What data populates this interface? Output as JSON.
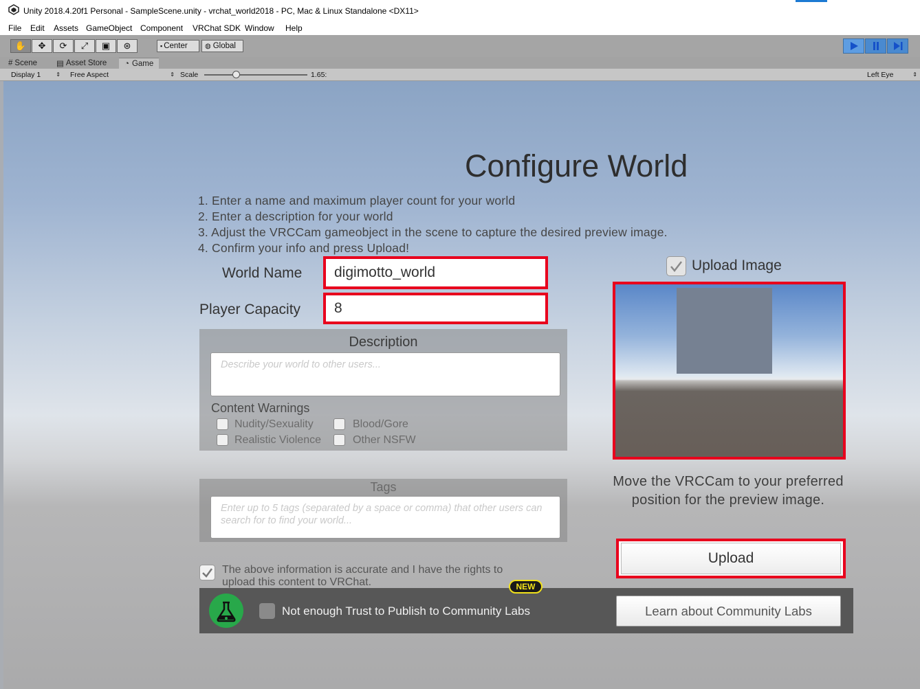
{
  "window": {
    "title": "Unity 2018.4.20f1 Personal - SampleScene.unity - vrchat_world2018 - PC, Mac & Linux Standalone <DX11>"
  },
  "menu": [
    "File",
    "Edit",
    "Assets",
    "GameObject",
    "Component",
    "VRChat SDK",
    "Window",
    "Help"
  ],
  "toolbar": {
    "tools": [
      "hand-tool",
      "move-tool",
      "rotate-tool",
      "scale-tool",
      "rect-tool",
      "transform-tool"
    ],
    "pivot_label": "Center",
    "rotation_label": "Global",
    "playback": [
      "play",
      "pause",
      "step"
    ]
  },
  "tabs": [
    {
      "label": "Scene",
      "icon": "grid-icon"
    },
    {
      "label": "Asset Store",
      "icon": "store-icon"
    },
    {
      "label": "Game",
      "icon": "pacman-icon",
      "active": true
    }
  ],
  "game_toolbar": {
    "display": "Display 1",
    "aspect": "Free Aspect",
    "scale_label": "Scale",
    "scale_value": "1.65:",
    "eye": "Left Eye"
  },
  "configure": {
    "heading": "Configure World",
    "steps": [
      "1. Enter a name and maximum player count for your world",
      "2. Enter a description for your world",
      "3. Adjust the VRCCam gameobject in the scene to capture the desired preview image.",
      "4. Confirm your info and press Upload!"
    ],
    "world_name_label": "World Name",
    "world_name_value": "digimotto_world",
    "player_capacity_label": "Player Capacity",
    "player_capacity_value": "8",
    "description_title": "Description",
    "description_placeholder": "Describe your world to other users...",
    "content_warnings_title": "Content Warnings",
    "warnings": [
      "Nudity/Sexuality",
      "Blood/Gore",
      "Realistic Violence",
      "Other NSFW"
    ],
    "tags_title": "Tags",
    "tags_placeholder": "Enter up to 5 tags (separated by a space or comma) that other users can search for to find your world...",
    "rights_text_1": "The above information is accurate and I have the rights to",
    "rights_text_2": "upload this content to VRChat.",
    "upload_image_label": "Upload Image",
    "upload_image_checked": true,
    "preview_caption_1": "Move the VRCCam to your preferred",
    "preview_caption_2": "position for the preview image.",
    "upload_button": "Upload",
    "new_badge": "NEW",
    "labs_text": "Not enough Trust to Publish to Community Labs",
    "labs_button": "Learn about Community Labs"
  },
  "colors": {
    "highlight": "#e8001d",
    "labs_green": "#28a84a",
    "badge_yellow": "#f2e21a"
  }
}
